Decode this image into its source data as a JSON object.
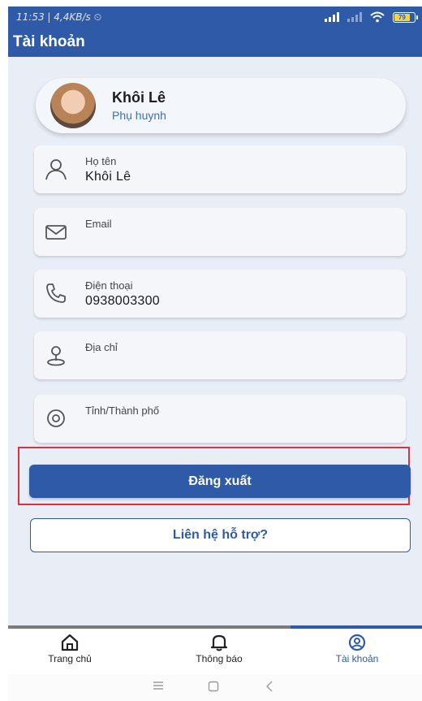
{
  "status_bar": {
    "time": "11:53 | 4,4KB/s",
    "battery": "79"
  },
  "header": {
    "title": "Tài khoản"
  },
  "profile": {
    "name": "Khôi Lê",
    "role": "Phụ huynh"
  },
  "fields": [
    {
      "label": "Họ tên",
      "value": "Khôi Lê",
      "icon": "person-icon"
    },
    {
      "label": "Email",
      "value": "",
      "icon": "envelope-icon"
    },
    {
      "label": "Điện thoại",
      "value": "0938003300",
      "icon": "phone-icon"
    },
    {
      "label": "Địa chỉ",
      "value": "",
      "icon": "map-pin-icon"
    },
    {
      "label": "Tỉnh/Thành phố",
      "value": "",
      "icon": "location-ring-icon"
    }
  ],
  "actions": {
    "logout_label": "Đăng xuất",
    "support_label": "Liên hệ hỗ trợ?"
  },
  "bottom_nav": [
    {
      "label": "Trang chủ",
      "icon": "home-icon",
      "active": false
    },
    {
      "label": "Thông báo",
      "icon": "bell-icon",
      "active": false
    },
    {
      "label": "Tài khoản",
      "icon": "account-icon",
      "active": true
    }
  ],
  "colors": {
    "primary": "#2f5aa8",
    "highlight": "#d9323f",
    "background": "#e9eef6"
  }
}
